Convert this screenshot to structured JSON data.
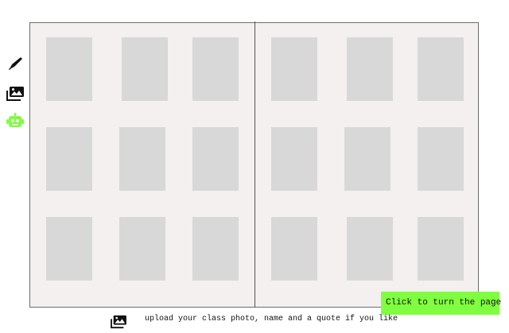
{
  "toolbar": {
    "tools": [
      {
        "icon": "pen-icon",
        "label": "Write"
      },
      {
        "icon": "photo-gallery-icon",
        "label": "Photos"
      },
      {
        "icon": "robot-icon",
        "label": "Bot",
        "color": "#7fff3f"
      }
    ]
  },
  "book": {
    "pages": [
      {
        "side": "left",
        "photo_rows": 3,
        "photo_cols": 3
      },
      {
        "side": "right",
        "photo_rows": 3,
        "photo_cols": 3
      }
    ]
  },
  "turn_page": {
    "label": "Click to turn the page",
    "color": "#7fff3f"
  },
  "upload": {
    "icon": "photo-gallery-icon",
    "text": "upload your class photo, name and a quote if you like"
  }
}
